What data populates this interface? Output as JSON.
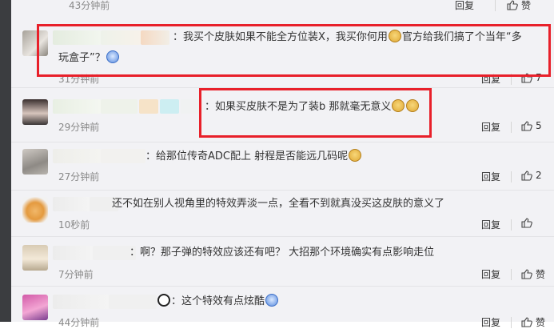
{
  "comments": [
    {
      "time": "43分钟前",
      "reply": "回复",
      "like_label": "赞",
      "like_count": ""
    },
    {
      "text": "：我买个皮肤如果不能全方位装X，我买你何用",
      "text2": "官方给我们搞了个当年“多",
      "text3": "玩盒子”？",
      "time": "31分钟前",
      "reply": "回复",
      "like_count": "7"
    },
    {
      "text": "：如果买皮肤不是为了装b 那就毫无意义",
      "time": "29分钟前",
      "reply": "回复",
      "like_count": "5"
    },
    {
      "text": "：给那位传奇ADC配上  射程是否能远几码呢",
      "time": "27分钟前",
      "reply": "回复",
      "like_count": "2"
    },
    {
      "text": "还不如在别人视角里的特效弄淡一点，全看不到就真没买这皮肤的意义了",
      "time": "10秒前",
      "reply": "回复",
      "like_count": ""
    },
    {
      "text": "：啊？那子弹的特效应该还有吧？ 大招那个环境确实有点影响走位",
      "time": "7分钟前",
      "reply": "回复",
      "like_label": "赞",
      "like_count": ""
    },
    {
      "text": "：这个特效有点炫酷",
      "time": "44分钟前",
      "reply": "回复",
      "like_label": "赞",
      "like_count": ""
    }
  ],
  "icons": {
    "like": "thumbs-up-icon",
    "emoji_doge": "doge-emoji-icon",
    "emoji_ghost": "ghost-emoji-icon",
    "emoji_panda": "panda-emoji-icon"
  },
  "colors": {
    "highlight": "#e8202a",
    "background": "#f2f2f5",
    "time": "#888888"
  }
}
